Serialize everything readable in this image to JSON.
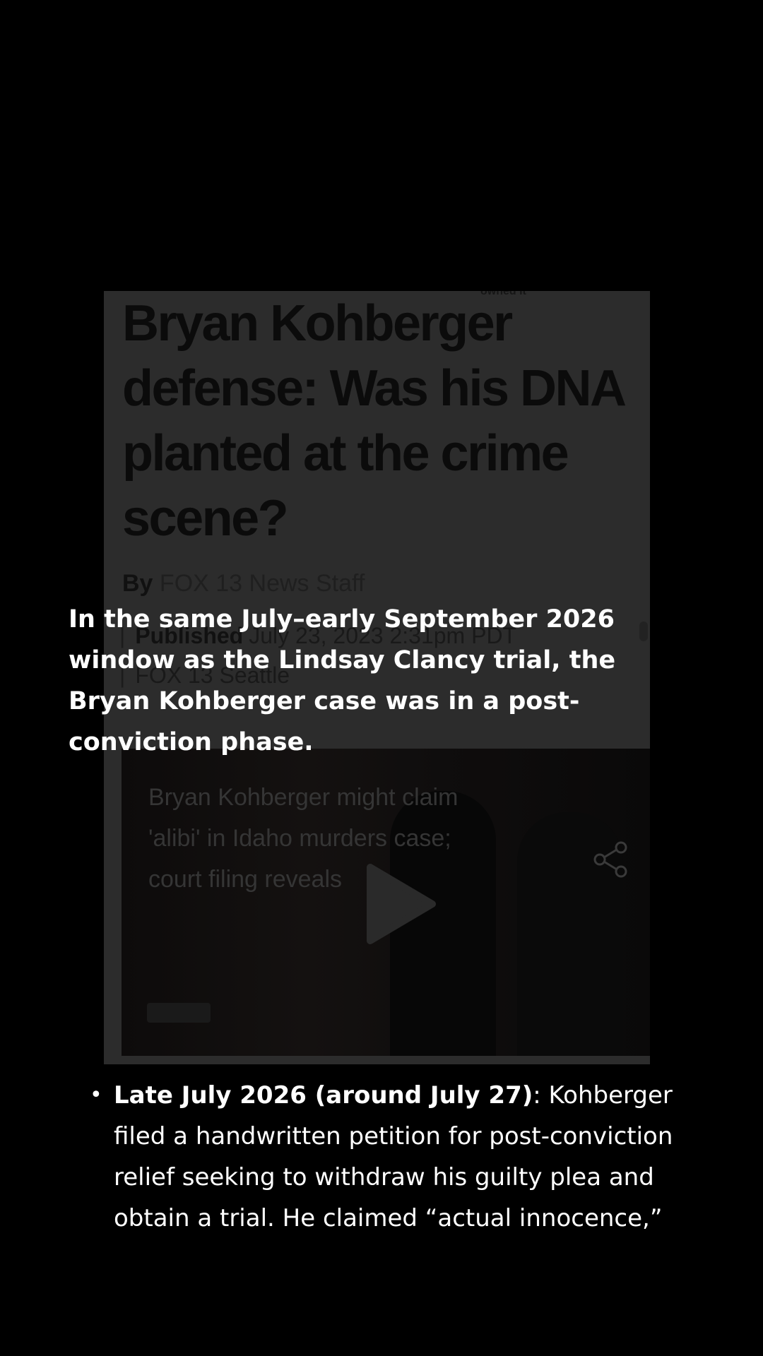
{
  "article": {
    "owned_label": "owned it",
    "headline": "Bryan Kohberger defense: Was his DNA planted at the crime scene?",
    "byline_label": "By",
    "byline_name": "FOX 13 News Staff",
    "published_label": "Published",
    "published_date": "July 23, 2023 2:31pm PDT",
    "source": "FOX 13 Seattle",
    "video_caption": "Bryan Kohberger might claim 'alibi' in Idaho murders case; court filing reveals",
    "icons": {
      "share": "share-icon",
      "play": "play-icon"
    }
  },
  "overlay_text": "In the same July–early September 2026 window as the Lindsay Clancy trial, the Bryan Kohberger case was in a post-conviction phase.",
  "bullets": [
    {
      "marker": "•",
      "lead": "Late July 2026 (around July 27)",
      "body": ": Kohberger filed a handwritten petition for post-conviction relief seeking to withdraw his guilty plea and obtain a trial. He claimed “actual innocence,”"
    }
  ],
  "colors": {
    "background": "#000000",
    "text": "#ffffff",
    "article_dim": "#2c2c2c"
  }
}
